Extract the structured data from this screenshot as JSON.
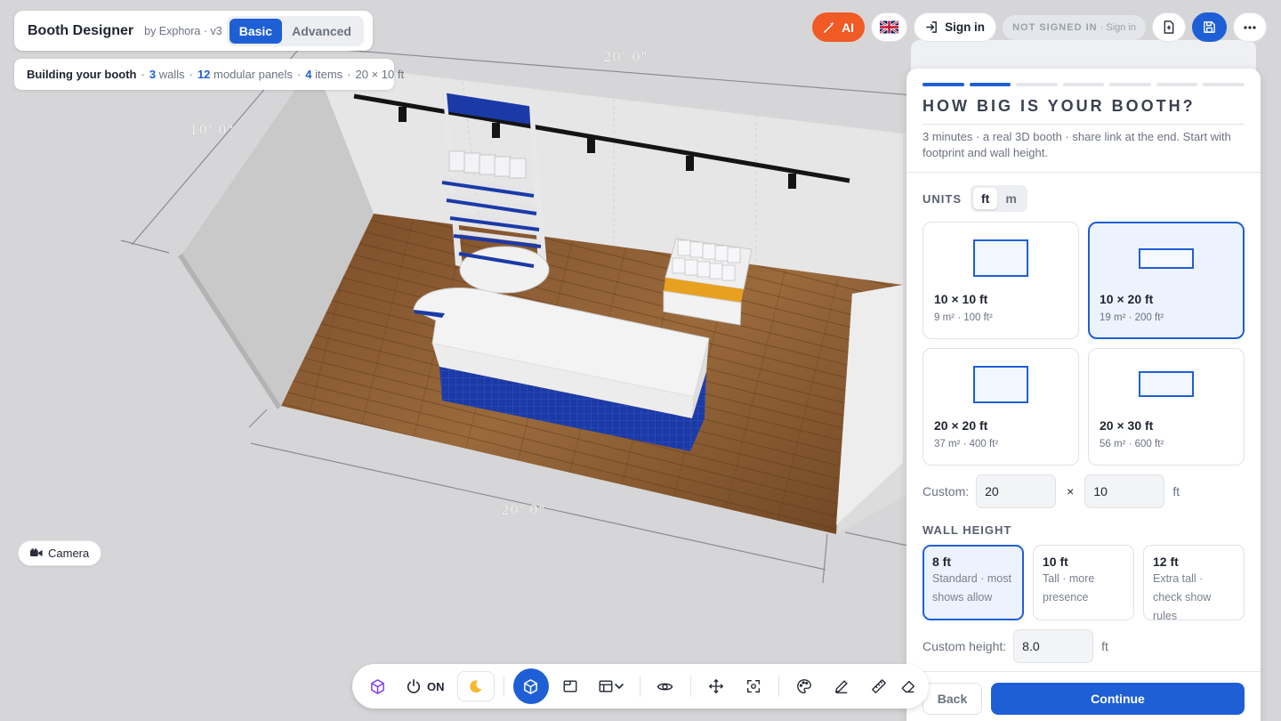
{
  "header": {
    "title": "Booth Designer",
    "subtitle": "by Exphora · v3",
    "modes": [
      "Basic",
      "Advanced"
    ],
    "active_mode": "Basic"
  },
  "build_status": {
    "label": "Building your booth",
    "walls_count": "3",
    "walls_text": "walls",
    "panels_count": "12",
    "panels_text": "modular panels",
    "items_count": "4",
    "items_text": "items",
    "size": "20 × 10 ft"
  },
  "top_bar": {
    "ai_label": "AI",
    "language_icon": "uk-flag-icon",
    "signin_label": "Sign in",
    "status_caps": "NOT SIGNED IN",
    "status_link": "Sign in"
  },
  "viewport": {
    "dim_back": "20' 0\"",
    "dim_left": "10' 0\"",
    "dim_front": "20' 0\""
  },
  "wizard": {
    "progress_total": 7,
    "progress_done": 2,
    "title": "HOW BIG IS YOUR BOOTH?",
    "description": "3 minutes · a real 3D booth · share link at the end. Start with footprint and wall height.",
    "units_label": "UNITS",
    "units": [
      "ft",
      "m"
    ],
    "active_unit": "ft",
    "sizes": [
      {
        "label": "10 × 10 ft",
        "area": "9 m² · 100 ft²",
        "selected": false
      },
      {
        "label": "10 × 20 ft",
        "area": "19 m² · 200 ft²",
        "selected": true
      },
      {
        "label": "20 × 20 ft",
        "area": "37 m² · 400 ft²",
        "selected": false
      },
      {
        "label": "20 × 30 ft",
        "area": "56 m² · 600 ft²",
        "selected": false
      }
    ],
    "custom_label": "Custom:",
    "custom_width": "20",
    "custom_times": "×",
    "custom_depth": "10",
    "custom_unit": "ft",
    "wall_height_label": "WALL HEIGHT",
    "heights": [
      {
        "label": "8 ft",
        "desc": "Standard · most shows allow",
        "selected": true
      },
      {
        "label": "10 ft",
        "desc": "Tall · more presence",
        "selected": false
      },
      {
        "label": "12 ft",
        "desc": "Extra tall · check show rules",
        "selected": false
      }
    ],
    "custom_height_label": "Custom height:",
    "custom_height_value": "8.0",
    "custom_height_unit": "ft",
    "back_label": "Back",
    "continue_label": "Continue"
  },
  "camera_label": "Camera",
  "bottom_bar": {
    "power_label": "ON",
    "tools": [
      "cube-outline-icon",
      "power-icon",
      "moon-icon",
      "cube-3d-icon",
      "floorplan-icon",
      "layout-icon",
      "chevron-down-icon",
      "eye-icon",
      "move-icon",
      "focus-icon",
      "palette-icon",
      "pen-icon",
      "ruler-icon",
      "eraser-icon"
    ]
  },
  "colors": {
    "accent": "#1f5fd6",
    "ai": "#f05a24",
    "booth_blue": "#1a3aa8",
    "floor": "#8a5a32"
  }
}
